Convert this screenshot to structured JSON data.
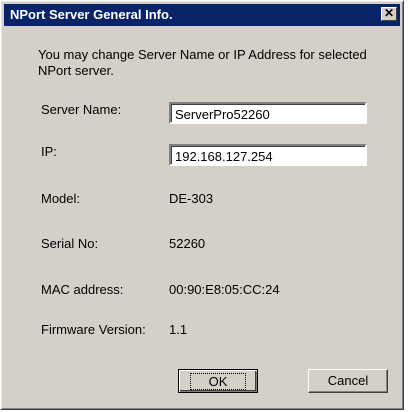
{
  "window": {
    "title": "NPort Server General Info.",
    "close_glyph": "✕"
  },
  "description": "You may change Server Name or IP Address for selected NPort server.",
  "fields": {
    "server_name": {
      "label": "Server Name:",
      "value": "ServerPro52260"
    },
    "ip": {
      "label": "IP:",
      "value": "192.168.127.254"
    }
  },
  "info": {
    "model": {
      "label": "Model:",
      "value": "DE-303"
    },
    "serial": {
      "label": "Serial No:",
      "value": "52260"
    },
    "mac": {
      "label": "MAC address:",
      "value": "00:90:E8:05:CC:24"
    },
    "firmware": {
      "label": "Firmware Version:",
      "value": "1.1"
    }
  },
  "buttons": {
    "ok": "OK",
    "cancel": "Cancel"
  },
  "colors": {
    "titlebar": "#0a246a",
    "face": "#d4d0c8"
  }
}
